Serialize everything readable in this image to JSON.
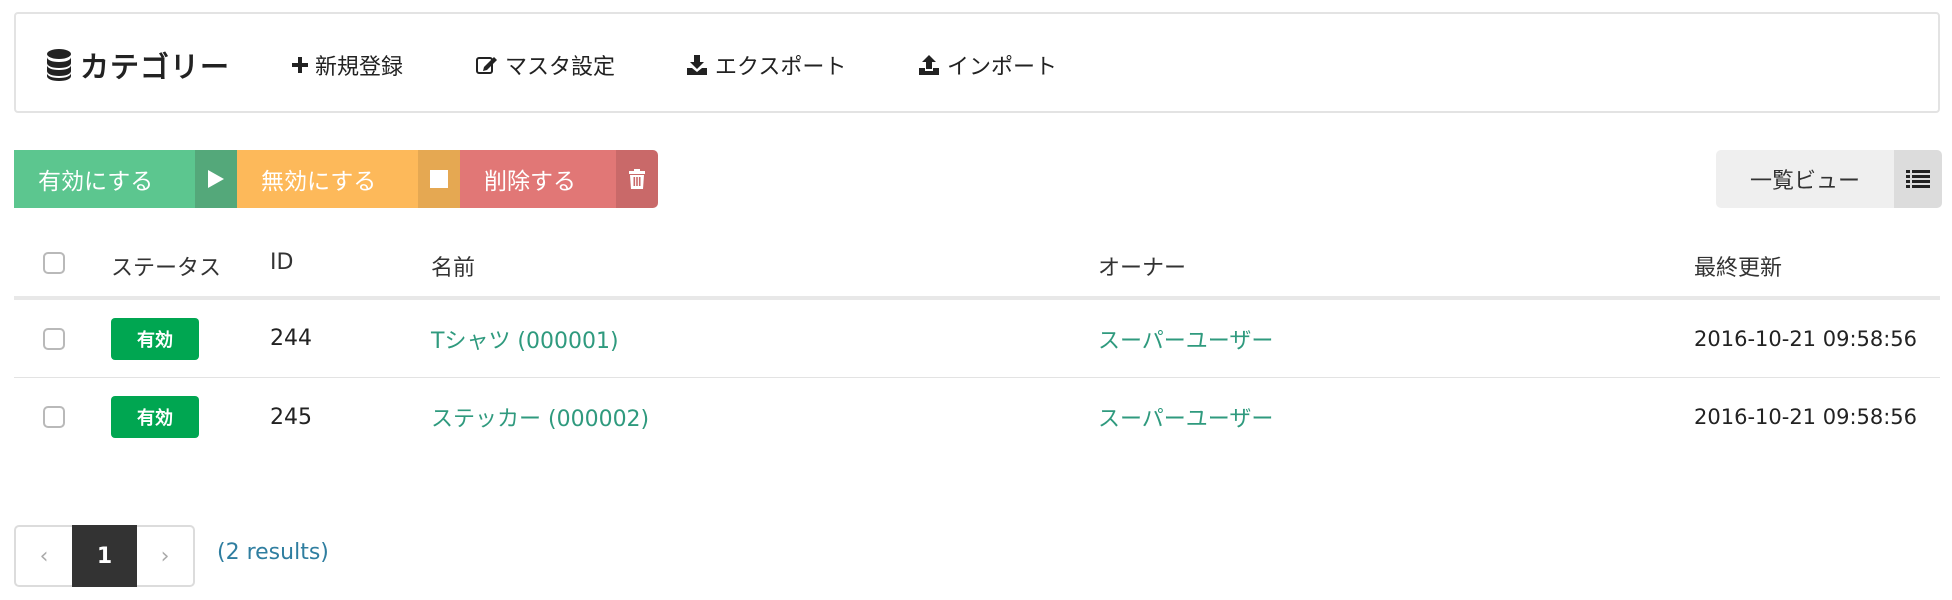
{
  "header": {
    "title": "カテゴリー",
    "title_icon": "database-icon",
    "menu": [
      {
        "label": "新規登録",
        "icon": "plus-icon"
      },
      {
        "label": "マスタ設定",
        "icon": "edit-icon"
      },
      {
        "label": "エクスポート",
        "icon": "download-icon"
      },
      {
        "label": "インポート",
        "icon": "upload-icon"
      }
    ]
  },
  "actions": {
    "enable": {
      "label": "有効にする",
      "icon": "play-icon",
      "color": "#5cc68f"
    },
    "disable": {
      "label": "無効にする",
      "icon": "stop-icon",
      "color": "#fdb95a"
    },
    "delete": {
      "label": "削除する",
      "icon": "trash-icon",
      "color": "#e17776"
    }
  },
  "view": {
    "label": "一覧ビュー",
    "icon": "list-icon"
  },
  "table": {
    "columns": [
      "ステータス",
      "ID",
      "名前",
      "オーナー",
      "最終更新"
    ],
    "rows": [
      {
        "status": "有効",
        "id": "244",
        "name": "Tシャツ (000001)",
        "owner": "スーパーユーザー",
        "updated": "2016-10-21 09:58:56"
      },
      {
        "status": "有効",
        "id": "245",
        "name": "ステッカー (000002)",
        "owner": "スーパーユーザー",
        "updated": "2016-10-21 09:58:56"
      }
    ]
  },
  "pagination": {
    "prev": "‹",
    "current": "1",
    "next": "›",
    "results": "(2 results)"
  },
  "colors": {
    "accent_link": "#2f9a7e",
    "badge_active": "#00a651"
  }
}
